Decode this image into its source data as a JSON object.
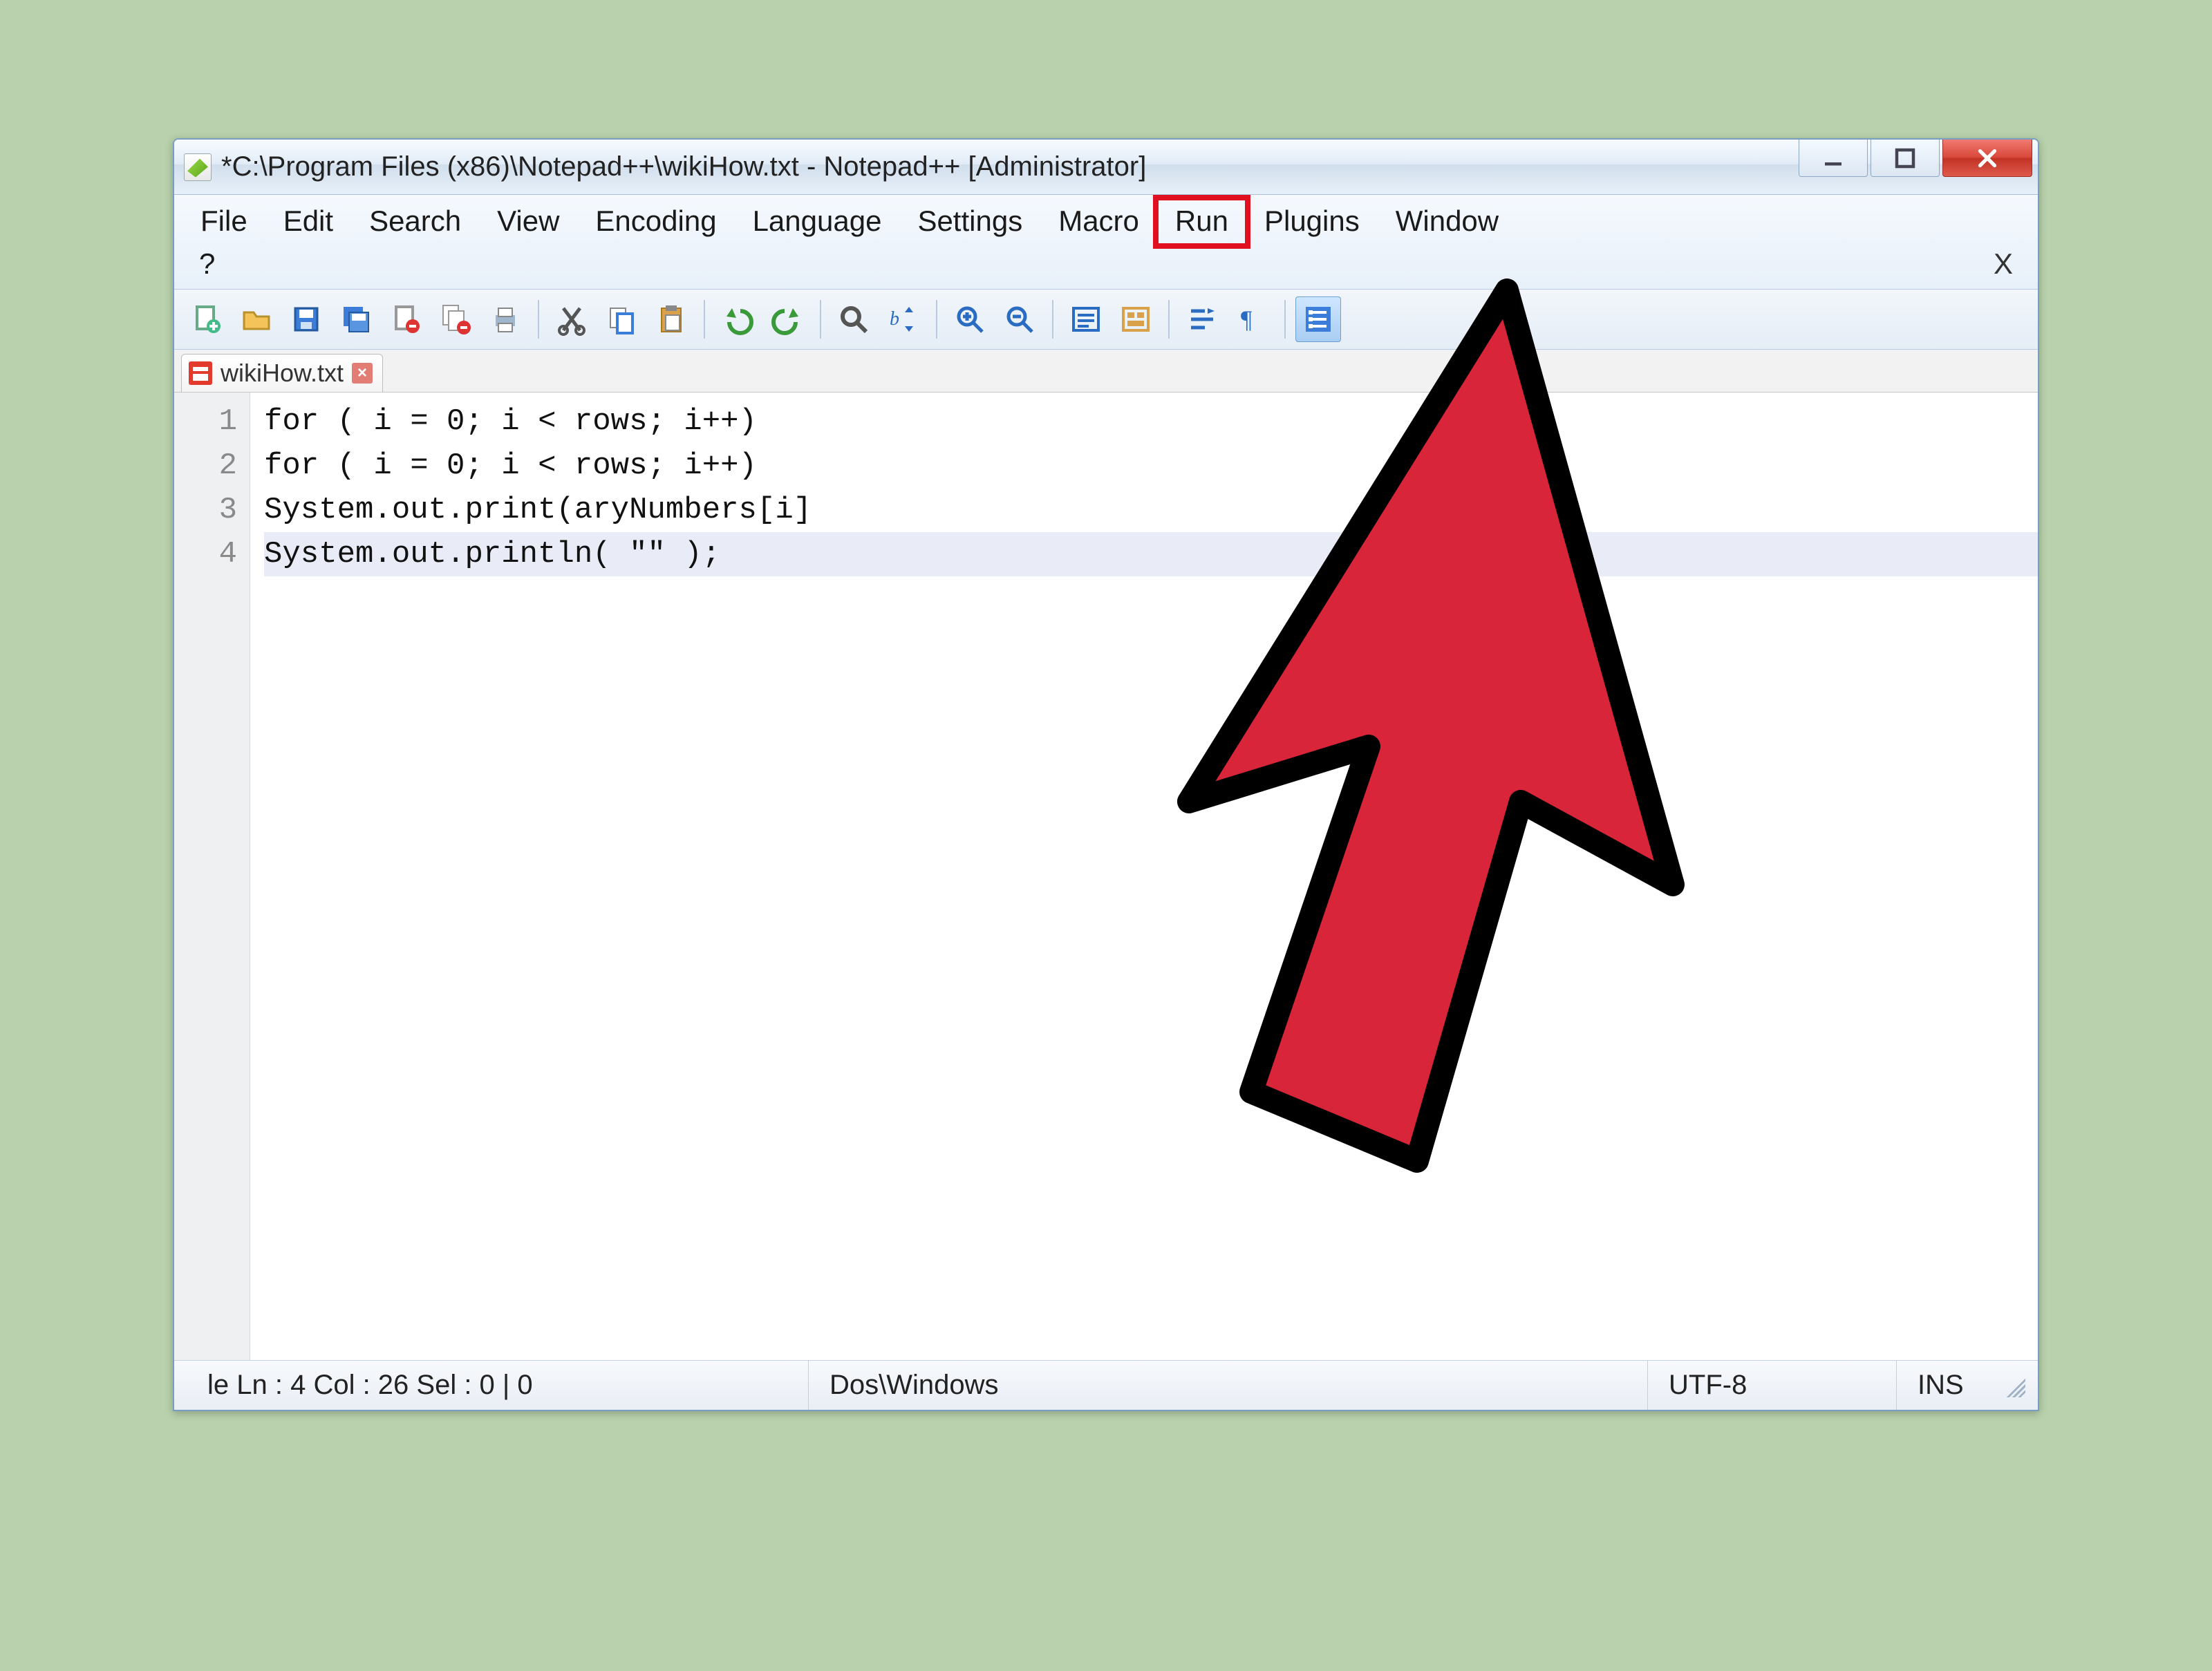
{
  "window": {
    "title": "*C:\\Program Files (x86)\\Notepad++\\wikiHow.txt - Notepad++ [Administrator]"
  },
  "menu": {
    "items": [
      "File",
      "Edit",
      "Search",
      "View",
      "Encoding",
      "Language",
      "Settings",
      "Macro",
      "Run",
      "Plugins",
      "Window"
    ],
    "highlighted_index": 8,
    "help": "?",
    "close_x": "X"
  },
  "toolbar": {
    "buttons": [
      "new-file",
      "open-file",
      "save",
      "save-all",
      "close-file",
      "close-all",
      "print",
      "|",
      "cut",
      "copy",
      "paste",
      "|",
      "undo",
      "redo",
      "|",
      "find",
      "find-replace",
      "|",
      "zoom-in",
      "zoom-out",
      "|",
      "wrap",
      "show-all",
      "|",
      "indent-guide",
      "pilcrow",
      "|",
      "function-list"
    ],
    "active": "function-list"
  },
  "tab": {
    "filename": "wikiHow.txt",
    "unsaved": true
  },
  "editor": {
    "lines": [
      "for ( i = 0; i < rows; i++)",
      "for ( i = 0; i < rows; i++)",
      "System.out.print(aryNumbers[i]",
      "System.out.println( \"\" );"
    ],
    "current_line_index": 3
  },
  "status": {
    "left": "le Ln : 4    Col : 26    Sel : 0 | 0",
    "eol": "Dos\\Windows",
    "encoding": "UTF-8",
    "mode": "INS"
  },
  "highlight": {
    "color": "#e01020"
  }
}
